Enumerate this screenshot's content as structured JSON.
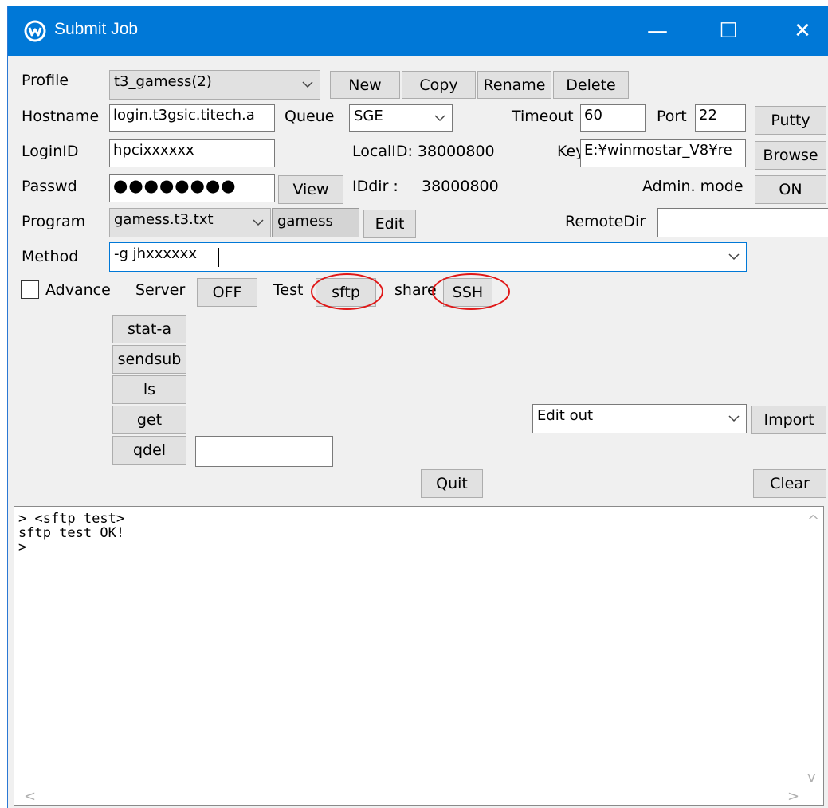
{
  "window": {
    "title": "Submit Job",
    "minimize": "—",
    "maximize": "☐",
    "close": "✕"
  },
  "profile": {
    "label": "Profile",
    "value": "t3_gamess(2)",
    "new_btn": "New",
    "copy_btn": "Copy",
    "rename_btn": "Rename",
    "delete_btn": "Delete"
  },
  "hostname": {
    "label": "Hostname",
    "value": "login.t3gsic.titech.a"
  },
  "queue": {
    "label": "Queue",
    "value": "SGE"
  },
  "timeout": {
    "label": "Timeout",
    "value": "60"
  },
  "port": {
    "label": "Port",
    "value": "22"
  },
  "putty_btn": "Putty",
  "loginid": {
    "label": "LoginID",
    "value": "hpcixxxxxx"
  },
  "localid": {
    "text": "LocalID: 38000800"
  },
  "key": {
    "label": "Key",
    "value": "E:¥winmostar_V8¥re"
  },
  "browse_btn": "Browse",
  "passwd": {
    "label": "Passwd",
    "value": "●●●●●●●●",
    "view_btn": "View"
  },
  "iddir": {
    "label": "IDdir :",
    "value": "38000800"
  },
  "admin": {
    "label": "Admin. mode",
    "btn": "ON"
  },
  "program": {
    "label": "Program",
    "value": "gamess.t3.txt",
    "name": "gamess",
    "edit_btn": "Edit"
  },
  "remotedir": {
    "label": "RemoteDir",
    "value": ""
  },
  "method": {
    "label": "Method",
    "value": "-g jhxxxxxx"
  },
  "advance": {
    "label": "Advance",
    "checked": false
  },
  "server": {
    "label": "Server",
    "btn": "OFF"
  },
  "test": {
    "label": "Test",
    "btn": "sftp"
  },
  "share": {
    "label": "share",
    "btn": "SSH"
  },
  "actions": {
    "stat": "stat-a",
    "sendsub": "sendsub",
    "ls": "ls",
    "get": "get",
    "qdel": "qdel",
    "qdel_value": ""
  },
  "editout": {
    "value": "Edit out",
    "import_btn": "Import"
  },
  "quit_btn": "Quit",
  "clear_btn": "Clear",
  "console": {
    "lines": [
      "> <sftp test>",
      "sftp test OK!",
      ">"
    ],
    "scroll_up": "^",
    "scroll_down": "v",
    "scroll_left": "<",
    "scroll_right": ">"
  },
  "colors": {
    "titlebar": "#0078d7",
    "annotation": "#e01818"
  }
}
